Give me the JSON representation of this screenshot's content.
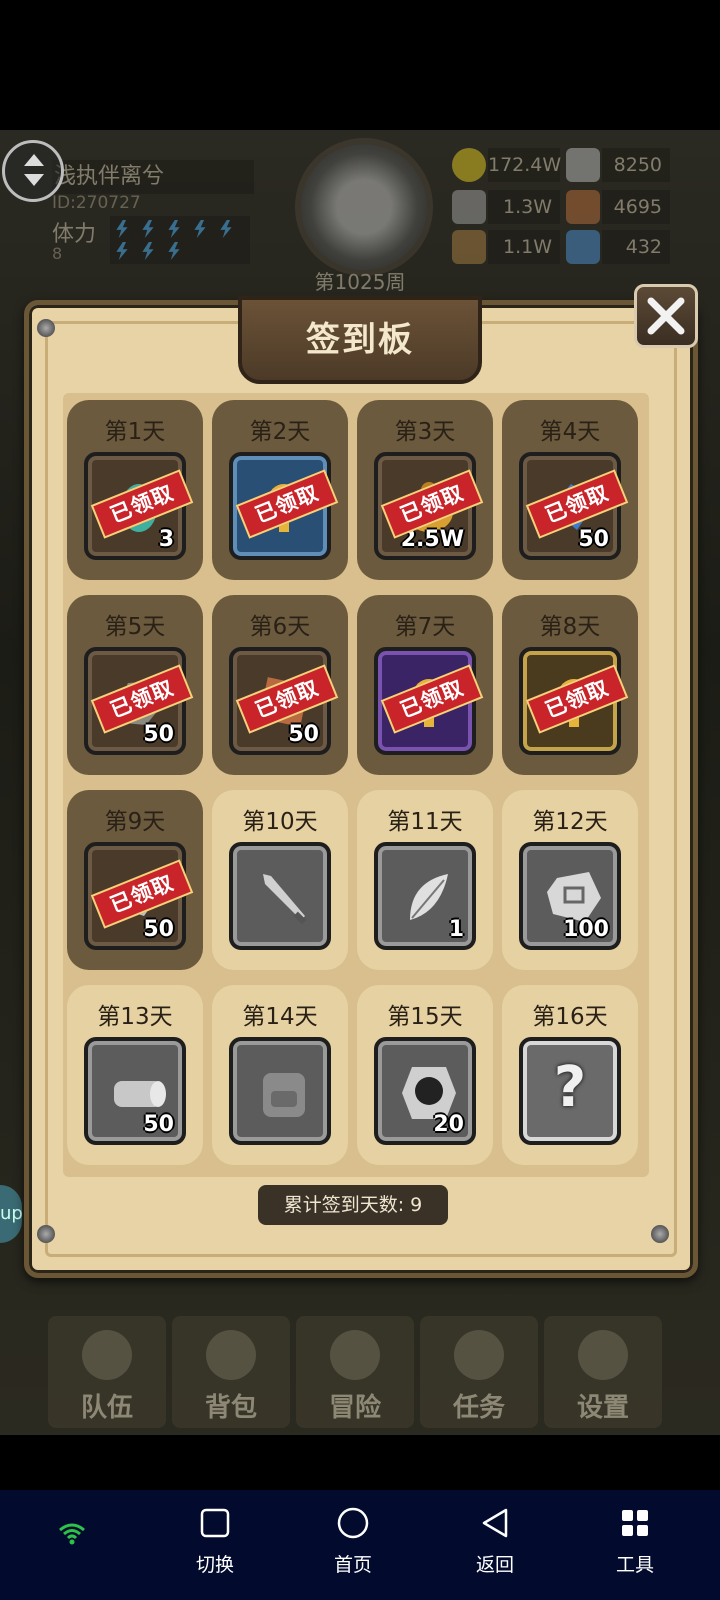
{
  "hud": {
    "player_name": "浅执伴离兮",
    "player_id": "ID:270727",
    "stamina_label": "体力",
    "stamina_value": "8",
    "week": "第1025周",
    "resources": [
      {
        "icon": "gold-coin-icon",
        "value": "172.4W",
        "color": "#d8c020"
      },
      {
        "icon": "iron-ingot-icon",
        "value": "8250",
        "color": "#b0b0b0"
      },
      {
        "icon": "ore-icon",
        "value": "1.3W",
        "color": "#9a9a9a"
      },
      {
        "icon": "leather-icon",
        "value": "4695",
        "color": "#b06a3a"
      },
      {
        "icon": "wood-log-icon",
        "value": "1.1W",
        "color": "#a07a40"
      },
      {
        "icon": "blue-crystal-icon",
        "value": "432",
        "color": "#4a8ac8"
      }
    ]
  },
  "side_tab": "up",
  "panel": {
    "title": "签到板",
    "claimed_stamp": "已领取",
    "total_label": "累计签到天数: 9",
    "days": [
      {
        "label": "第1天",
        "claimed": true,
        "frame": "brown",
        "item": "egg-item-icon",
        "qty": "3"
      },
      {
        "label": "第2天",
        "claimed": true,
        "frame": "blue",
        "item": "mystery-key-icon",
        "qty": ""
      },
      {
        "label": "第3天",
        "claimed": true,
        "frame": "brown",
        "item": "gold-bag-icon",
        "qty": "2.5W"
      },
      {
        "label": "第4天",
        "claimed": true,
        "frame": "brown",
        "item": "blue-crystal-icon",
        "qty": "50"
      },
      {
        "label": "第5天",
        "claimed": true,
        "frame": "brown",
        "item": "ore-icon",
        "qty": "50"
      },
      {
        "label": "第6天",
        "claimed": true,
        "frame": "brown",
        "item": "leather-icon",
        "qty": "50"
      },
      {
        "label": "第7天",
        "claimed": true,
        "frame": "purple",
        "item": "mystery-key-icon",
        "qty": ""
      },
      {
        "label": "第8天",
        "claimed": true,
        "frame": "gold",
        "item": "mystery-key-icon",
        "qty": ""
      },
      {
        "label": "第9天",
        "claimed": true,
        "frame": "brown",
        "item": "iron-ingot-icon",
        "qty": "50"
      },
      {
        "label": "第10天",
        "claimed": false,
        "frame": "grey",
        "item": "sword-icon",
        "qty": ""
      },
      {
        "label": "第11天",
        "claimed": false,
        "frame": "grey",
        "item": "feather-icon",
        "qty": "1"
      },
      {
        "label": "第12天",
        "claimed": false,
        "frame": "grey",
        "item": "rune-stone-icon",
        "qty": "100"
      },
      {
        "label": "第13天",
        "claimed": false,
        "frame": "grey",
        "item": "wood-log-icon",
        "qty": "50"
      },
      {
        "label": "第14天",
        "claimed": false,
        "frame": "grey",
        "item": "backpack-icon",
        "qty": ""
      },
      {
        "label": "第15天",
        "claimed": false,
        "frame": "grey",
        "item": "emblem-stone-icon",
        "qty": "20"
      },
      {
        "label": "第16天",
        "claimed": false,
        "frame": "silver",
        "item": "question-mark-icon",
        "qty": "?"
      }
    ]
  },
  "game_nav": [
    "队伍",
    "背包",
    "冒险",
    "任务",
    "设置"
  ],
  "system_nav": [
    "切换",
    "首页",
    "返回",
    "工具"
  ]
}
